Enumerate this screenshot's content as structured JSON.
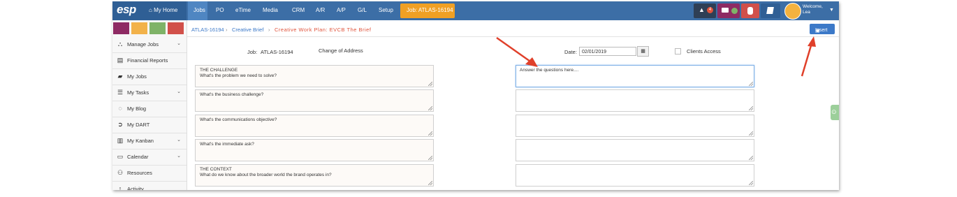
{
  "nav": {
    "logo": "esp",
    "home": "My Home",
    "items": [
      "Jobs",
      "PO",
      "eTime",
      "Media",
      "CRM",
      "A/R",
      "A/P",
      "G/L",
      "Setup"
    ],
    "job_button": "Job: ATLAS-16194",
    "notification_count": "4",
    "welcome_line1": "Welcome,",
    "welcome_line2": "Lea"
  },
  "sidebar": {
    "swatch_colors": [
      "#8e2a63",
      "#f2b24a",
      "#7fb368",
      "#d1504a"
    ],
    "items": [
      {
        "label": "Manage Jobs",
        "icon": "sitemap-icon",
        "chevron": true
      },
      {
        "label": "Financial Reports",
        "icon": "report-icon",
        "chevron": false
      },
      {
        "label": "My Jobs",
        "icon": "folder-open-icon",
        "chevron": false
      },
      {
        "label": "My Tasks",
        "icon": "tasks-icon",
        "chevron": true
      },
      {
        "label": "My Blog",
        "icon": "chat-icon",
        "chevron": false
      },
      {
        "label": "My DART",
        "icon": "arrow-circle-icon",
        "chevron": false
      },
      {
        "label": "My Kanban",
        "icon": "kanban-icon",
        "chevron": true
      },
      {
        "label": "Calendar",
        "icon": "calendar-icon",
        "chevron": true
      },
      {
        "label": "Resources",
        "icon": "users-icon",
        "chevron": false
      },
      {
        "label": "Activity",
        "icon": "activity-icon",
        "chevron": false
      }
    ]
  },
  "breadcrumb": {
    "item1": "ATLAS-16194",
    "item2": "Creative Brief",
    "current": "Creative Work Plan: EVCB The Brief",
    "separator": "›"
  },
  "toolbar": {
    "insert_label": "Insert"
  },
  "form": {
    "job_label": "Job:",
    "job_value": "ATLAS-16194",
    "change_label": "Change of Address",
    "date_label": "Date:",
    "date_value": "02/01/2019",
    "clients_access_label": "Clients Access",
    "questions": [
      {
        "line1": "THE CHALLENGE",
        "line2": "What's the problem we need to solve?"
      },
      {
        "line1": "What's the business challenge?",
        "line2": ""
      },
      {
        "line1": "What's the communications objective?",
        "line2": ""
      },
      {
        "line1": "What's the immediate ask?",
        "line2": ""
      },
      {
        "line1": "THE CONTEXT",
        "line2": "What do we know about the broader world the brand operates in?"
      }
    ],
    "answers": [
      "Answer the questions here....",
      "",
      "",
      "",
      ""
    ]
  },
  "colors": {
    "nav_bg": "#3c6ea6",
    "accent_orange": "#f0a024",
    "insert_blue": "#3c79c8",
    "breadcrumb_current": "#e0523a",
    "annotation_arrow": "#e0402a"
  }
}
